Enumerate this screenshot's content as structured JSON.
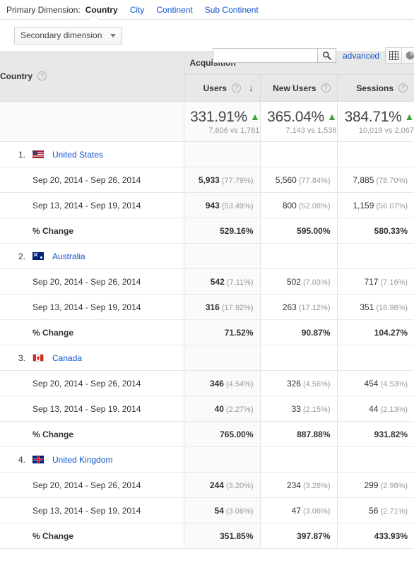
{
  "primary_dimension": {
    "label": "Primary Dimension:",
    "tabs": [
      {
        "label": "Country",
        "active": true
      },
      {
        "label": "City",
        "active": false
      },
      {
        "label": "Continent",
        "active": false
      },
      {
        "label": "Sub Continent",
        "active": false
      }
    ]
  },
  "controls": {
    "secondary_dimension_label": "Secondary dimension",
    "search_value": "",
    "search_placeholder": "",
    "advanced_label": "advanced",
    "search_icon": "search-icon",
    "table-view-icon": "grid-icon",
    "pie-view-icon": "pie-chart-icon"
  },
  "table": {
    "group_header": "Acquisition",
    "dimension_header": "Country",
    "help_glyph": "?",
    "sort_arrow_glyph": "↓",
    "up_arrow_glyph": "▲",
    "metrics": [
      {
        "label": "Users",
        "sorted": true
      },
      {
        "label": "New Users",
        "sorted": false
      },
      {
        "label": "Sessions",
        "sorted": false
      }
    ],
    "summary": [
      {
        "percent": "331.91%",
        "comparison": "7,606 vs 1,761",
        "direction": "up"
      },
      {
        "percent": "365.04%",
        "comparison": "7,143 vs 1,536",
        "direction": "up"
      },
      {
        "percent": "384.71%",
        "comparison": "10,019 vs 2,067",
        "direction": "up"
      }
    ],
    "row_labels": {
      "period_current": "Sep 20, 2014 - Sep 26, 2014",
      "period_previous": "Sep 13, 2014 - Sep 19, 2014",
      "pct_change": "% Change"
    },
    "countries": [
      {
        "rank": "1.",
        "name": "United States",
        "flag": "flag-us",
        "current": [
          {
            "value": "5,933",
            "pct": "(77.79%)"
          },
          {
            "value": "5,560",
            "pct": "(77.84%)"
          },
          {
            "value": "7,885",
            "pct": "(78.70%)"
          }
        ],
        "previous": [
          {
            "value": "943",
            "pct": "(53.49%)"
          },
          {
            "value": "800",
            "pct": "(52.08%)"
          },
          {
            "value": "1,159",
            "pct": "(56.07%)"
          }
        ],
        "change": [
          "529.16%",
          "595.00%",
          "580.33%"
        ]
      },
      {
        "rank": "2.",
        "name": "Australia",
        "flag": "flag-au",
        "current": [
          {
            "value": "542",
            "pct": "(7.11%)"
          },
          {
            "value": "502",
            "pct": "(7.03%)"
          },
          {
            "value": "717",
            "pct": "(7.16%)"
          }
        ],
        "previous": [
          {
            "value": "316",
            "pct": "(17.92%)"
          },
          {
            "value": "263",
            "pct": "(17.12%)"
          },
          {
            "value": "351",
            "pct": "(16.98%)"
          }
        ],
        "change": [
          "71.52%",
          "90.87%",
          "104.27%"
        ]
      },
      {
        "rank": "3.",
        "name": "Canada",
        "flag": "flag-ca",
        "current": [
          {
            "value": "346",
            "pct": "(4.54%)"
          },
          {
            "value": "326",
            "pct": "(4.56%)"
          },
          {
            "value": "454",
            "pct": "(4.53%)"
          }
        ],
        "previous": [
          {
            "value": "40",
            "pct": "(2.27%)"
          },
          {
            "value": "33",
            "pct": "(2.15%)"
          },
          {
            "value": "44",
            "pct": "(2.13%)"
          }
        ],
        "change": [
          "765.00%",
          "887.88%",
          "931.82%"
        ]
      },
      {
        "rank": "4.",
        "name": "United Kingdom",
        "flag": "flag-gb",
        "current": [
          {
            "value": "244",
            "pct": "(3.20%)"
          },
          {
            "value": "234",
            "pct": "(3.28%)"
          },
          {
            "value": "299",
            "pct": "(2.98%)"
          }
        ],
        "previous": [
          {
            "value": "54",
            "pct": "(3.06%)"
          },
          {
            "value": "47",
            "pct": "(3.06%)"
          },
          {
            "value": "56",
            "pct": "(2.71%)"
          }
        ],
        "change": [
          "351.85%",
          "397.87%",
          "433.93%"
        ]
      }
    ]
  },
  "colors": {
    "link": "#1155cc",
    "positive": "#3aa23a",
    "header_bg": "#e8e8e8",
    "shaded_col": "#fafafa"
  }
}
